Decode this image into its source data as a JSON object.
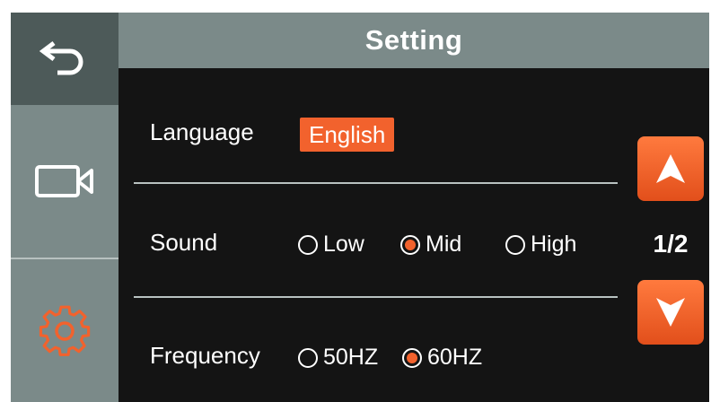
{
  "header": {
    "title": "Setting"
  },
  "sidebar": {
    "items": [
      {
        "name": "back",
        "icon": "back-arrow-icon"
      },
      {
        "name": "video",
        "icon": "video-camera-icon"
      },
      {
        "name": "settings",
        "icon": "gear-icon",
        "active": true
      }
    ]
  },
  "settings": {
    "language": {
      "label": "Language",
      "value": "English"
    },
    "sound": {
      "label": "Sound",
      "options": [
        "Low",
        "Mid",
        "High"
      ],
      "selected": "Mid"
    },
    "frequency": {
      "label": "Frequency",
      "options": [
        "50HZ",
        "60HZ"
      ],
      "selected": "60HZ"
    }
  },
  "pagination": {
    "indicator": "1/2"
  },
  "colors": {
    "accent": "#f2622d",
    "sidebar": "#7b8a89",
    "sidebar_active": "#4d5a59",
    "background": "#141414"
  }
}
